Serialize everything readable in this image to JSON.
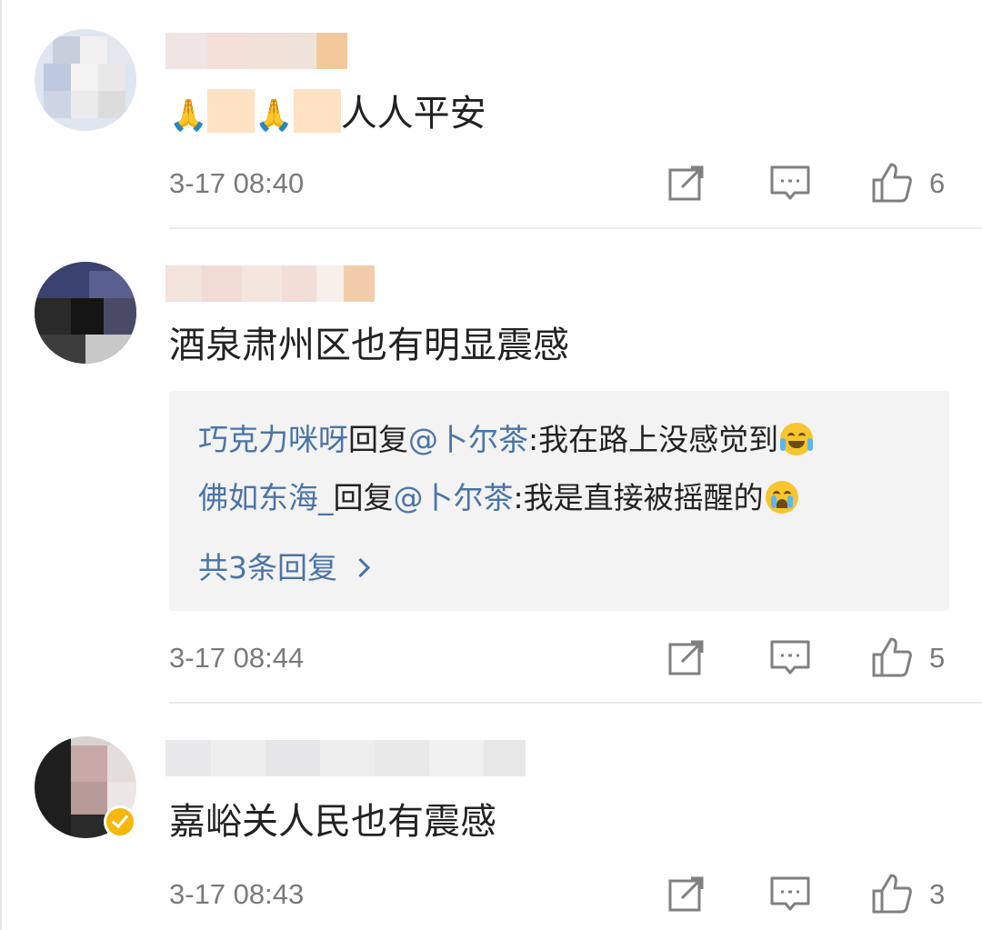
{
  "comments": [
    {
      "content_suffix": "人人平安",
      "time": "3-17 08:40",
      "likes": "6"
    },
    {
      "content": "酒泉肃州区也有明显震感",
      "time": "3-17 08:44",
      "likes": "5",
      "replies": [
        {
          "user": "巧克力咪呀",
          "reply_word": "回复",
          "mention": "@卜尔茶",
          "text": ":我在路上没感觉到",
          "emoji": "laugh-cry-emoji"
        },
        {
          "user": "佛如东海_",
          "reply_word": "回复",
          "mention": "@卜尔茶",
          "text": ":我是直接被摇醒的",
          "emoji": "crying-emoji"
        }
      ],
      "more_replies": "共3条回复"
    },
    {
      "content": "嘉峪关人民也有震感",
      "time": "3-17 08:43",
      "likes": "3"
    }
  ],
  "icons": {
    "share": "share-icon",
    "comment": "comment-icon",
    "like": "thumbs-up-icon",
    "pray": "🙏"
  },
  "colors": {
    "link": "#4a74a8",
    "meta": "#7a7a7a",
    "reply_bg": "#f3f3f3",
    "verified": "#f5b80b"
  }
}
